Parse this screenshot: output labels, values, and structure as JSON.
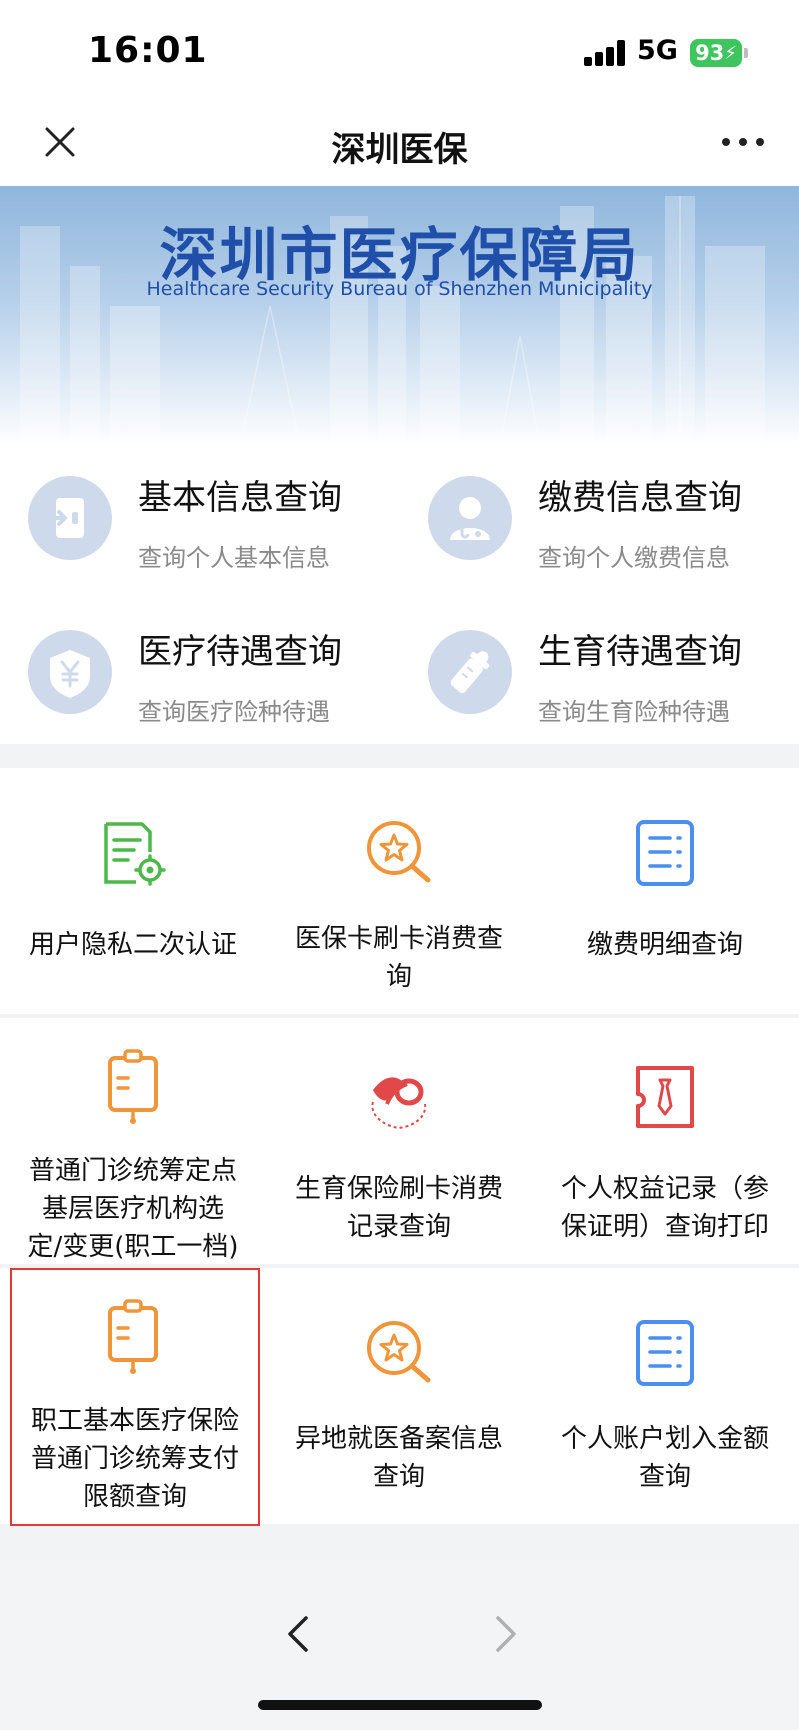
{
  "status": {
    "time": "16:01",
    "network": "5G",
    "battery": "93"
  },
  "navbar": {
    "title": "深圳医保",
    "close_icon": "close-icon",
    "more_icon": "more-icon"
  },
  "banner": {
    "title": "深圳市医疗保障局",
    "subtitle": "Healthcare Security Bureau of Shenzhen Municipality"
  },
  "quick": [
    {
      "title": "基本信息查询",
      "sub": "查询个人基本信息",
      "icon": "id-card-icon"
    },
    {
      "title": "缴费信息查询",
      "sub": "查询个人缴费信息",
      "icon": "doctor-icon"
    },
    {
      "title": "医疗待遇查询",
      "sub": "查询医疗险种待遇",
      "icon": "yuan-shield-icon"
    },
    {
      "title": "生育待遇查询",
      "sub": "查询生育险种待遇",
      "icon": "baby-bottle-icon"
    }
  ],
  "services": [
    {
      "label": "用户隐私二次认证",
      "icon": "document-gear-icon"
    },
    {
      "label": "医保卡刷卡消费查询",
      "icon": "star-search-icon"
    },
    {
      "label": "缴费明细查询",
      "icon": "list-document-icon"
    },
    {
      "label": "普通门诊统筹定点基层医疗机构选定/变更(职工一档)",
      "icon": "clipboard-icon"
    },
    {
      "label": "生育保险刷卡消费记录查询",
      "icon": "maternity-logo-icon"
    },
    {
      "label": "个人权益记录（参保证明）查询打印",
      "icon": "certificate-icon"
    },
    {
      "label": "职工基本医疗保险普通门诊统筹支付限额查询",
      "icon": "clipboard-icon"
    },
    {
      "label": "异地就医备案信息查询",
      "icon": "star-search-icon"
    },
    {
      "label": "个人账户划入金额查询",
      "icon": "list-document-icon"
    }
  ],
  "service_lines": [
    [
      "用户隐私二次认证"
    ],
    [
      "医保卡刷卡消费查",
      "询"
    ],
    [
      "缴费明细查询"
    ],
    [
      "普通门诊统筹定点",
      "基层医疗机构选",
      "定/变更(职工一档)"
    ],
    [
      "生育保险刷卡消费",
      "记录查询"
    ],
    [
      "个人权益记录（参",
      "保证明）查询打印"
    ],
    [
      "职工基本医疗保险",
      "普通门诊统筹支付",
      "限额查询"
    ],
    [
      "异地就医备案信息",
      "查询"
    ],
    [
      "个人账户划入金额",
      "查询"
    ]
  ],
  "colors": {
    "green": "#4cb848",
    "orange": "#f0953a",
    "blue": "#4a8ef0",
    "red": "#e0484a",
    "highlight": "#e53935",
    "banner_text": "#1f4fa8"
  },
  "bottom": {
    "back_icon": "chevron-left-icon",
    "forward_icon": "chevron-right-icon"
  }
}
